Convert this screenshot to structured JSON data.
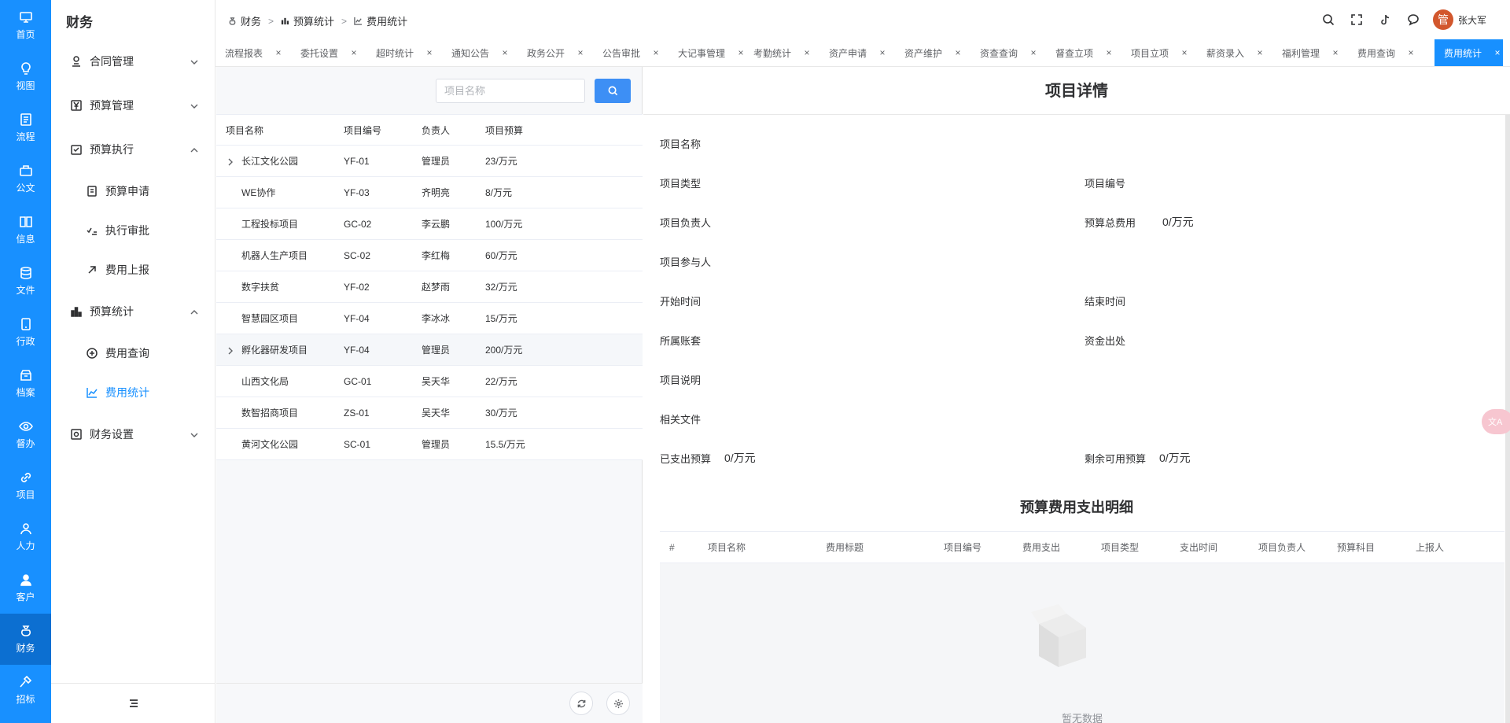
{
  "rail": [
    {
      "label": "首页",
      "icon": "monitor-icon"
    },
    {
      "label": "视图",
      "icon": "bulb-icon"
    },
    {
      "label": "流程",
      "icon": "flow-doc-icon"
    },
    {
      "label": "公文",
      "icon": "briefcase-icon"
    },
    {
      "label": "信息",
      "icon": "book-icon"
    },
    {
      "label": "文件",
      "icon": "database-icon"
    },
    {
      "label": "行政",
      "icon": "phone-icon"
    },
    {
      "label": "档案",
      "icon": "archive-icon"
    },
    {
      "label": "督办",
      "icon": "eye-icon"
    },
    {
      "label": "项目",
      "icon": "link-icon"
    },
    {
      "label": "人力",
      "icon": "user-outline-icon"
    },
    {
      "label": "客户",
      "icon": "user-solid-icon"
    },
    {
      "label": "财务",
      "icon": "money-bag-icon"
    },
    {
      "label": "招标",
      "icon": "hammer-icon"
    }
  ],
  "sidebar": {
    "title": "财务",
    "items": [
      {
        "label": "合同管理"
      },
      {
        "label": "预算管理"
      },
      {
        "label": "预算执行"
      },
      {
        "label": "预算申请"
      },
      {
        "label": "执行审批"
      },
      {
        "label": "费用上报"
      },
      {
        "label": "预算统计"
      },
      {
        "label": "费用查询"
      },
      {
        "label": "费用统计"
      },
      {
        "label": "财务设置"
      }
    ]
  },
  "breadcrumb": [
    "财务",
    "预算统计",
    "费用统计"
  ],
  "user": {
    "avatar_char": "管",
    "name": "张大军"
  },
  "tabs": [
    "流程报表",
    "委托设置",
    "超时统计",
    "通知公告",
    "政务公开",
    "公告审批",
    "大记事管理",
    "考勤统计",
    "资产申请",
    "资产维护",
    "资查查询",
    "督查立项",
    "项目立项",
    "薪资录入",
    "福利管理",
    "费用查询",
    "费用统计"
  ],
  "tab_close": "×",
  "search": {
    "placeholder": "项目名称"
  },
  "list": {
    "headers": [
      "项目名称",
      "项目编号",
      "负责人",
      "项目预算"
    ],
    "rows": [
      [
        "长江文化公园",
        "YF-01",
        "管理员",
        "23/万元"
      ],
      [
        "WE协作",
        "YF-03",
        "齐明亮",
        "8/万元"
      ],
      [
        "工程投标项目",
        "GC-02",
        "李云鹏",
        "100/万元"
      ],
      [
        "机器人生产项目",
        "SC-02",
        "李红梅",
        "60/万元"
      ],
      [
        "数字扶贫",
        "YF-02",
        "赵梦雨",
        "32/万元"
      ],
      [
        "智慧园区项目",
        "YF-04",
        "李冰冰",
        "15/万元"
      ],
      [
        "孵化器研发项目",
        "YF-04",
        "管理员",
        "200/万元"
      ],
      [
        "山西文化局",
        "GC-01",
        "吴天华",
        "22/万元"
      ],
      [
        "数智招商项目",
        "ZS-01",
        "吴天华",
        "30/万元"
      ],
      [
        "黄河文化公园",
        "SC-01",
        "管理员",
        "15.5/万元"
      ]
    ]
  },
  "detail": {
    "title": "项目详情",
    "fields": {
      "name": "项目名称",
      "type": "项目类型",
      "code": "项目编号",
      "owner": "项目负责人",
      "total_budget": "预算总费用",
      "total_budget_value": "0/万元",
      "participants": "项目参与人",
      "start": "开始时间",
      "end": "结束时间",
      "account": "所属账套",
      "fund_source": "资金出处",
      "desc": "项目说明",
      "files": "相关文件",
      "spent": "已支出预算",
      "spent_value": "0/万元",
      "remaining": "剩余可用预算",
      "remaining_value": "0/万元"
    },
    "expense_title": "预算费用支出明细",
    "expense_headers": [
      "#",
      "项目名称",
      "费用标题",
      "项目编号",
      "费用支出",
      "项目类型",
      "支出时间",
      "项目负责人",
      "预算科目",
      "上报人"
    ],
    "empty_text": "暂无数据"
  }
}
